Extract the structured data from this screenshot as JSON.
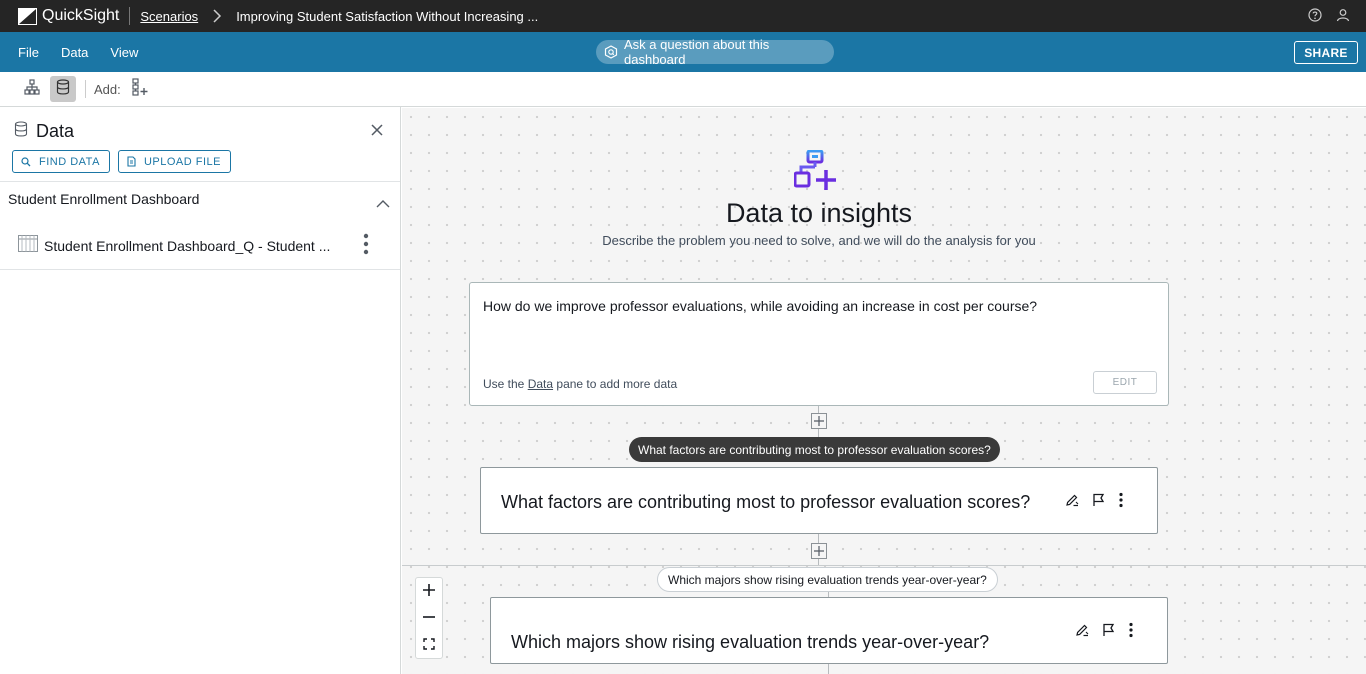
{
  "app": {
    "logo_text": "QuickSight",
    "breadcrumb_link": "Scenarios",
    "breadcrumb_title": "Improving Student Satisfaction Without Increasing ..."
  },
  "menubar": {
    "items": [
      "File",
      "Data",
      "View"
    ],
    "ask_label": "Ask a question about this dashboard",
    "share_label": "SHARE"
  },
  "toolbar": {
    "add_label": "Add:"
  },
  "data_panel": {
    "title": "Data",
    "find_data_label": "FIND DATA",
    "upload_file_label": "UPLOAD FILE",
    "section_title": "Student Enrollment Dashboard",
    "dataset_name": "Student Enrollment Dashboard_Q - Student ..."
  },
  "canvas": {
    "hero_title": "Data to insights",
    "hero_subtitle": "Describe the problem you need to solve, and we will do the analysis for you",
    "prompt_text": "How do we improve professor evaluations, while avoiding an increase in cost per course?",
    "prompt_footer_pre": "Use the ",
    "prompt_footer_link": "Data",
    "prompt_footer_post": " pane to add more data",
    "edit_label": "EDIT",
    "tooltip_1": "What factors are contributing most to professor evaluation scores?",
    "question_1": "What factors are contributing most to professor evaluation scores?",
    "tooltip_2": "Which majors show rising evaluation trends year-over-year?",
    "question_2": "Which majors show rising evaluation trends year-over-year?"
  },
  "colors": {
    "topbar": "#252525",
    "menubar": "#1b76a5",
    "accent": "#1b76a5",
    "canvas_bg": "#f5f5f5"
  }
}
